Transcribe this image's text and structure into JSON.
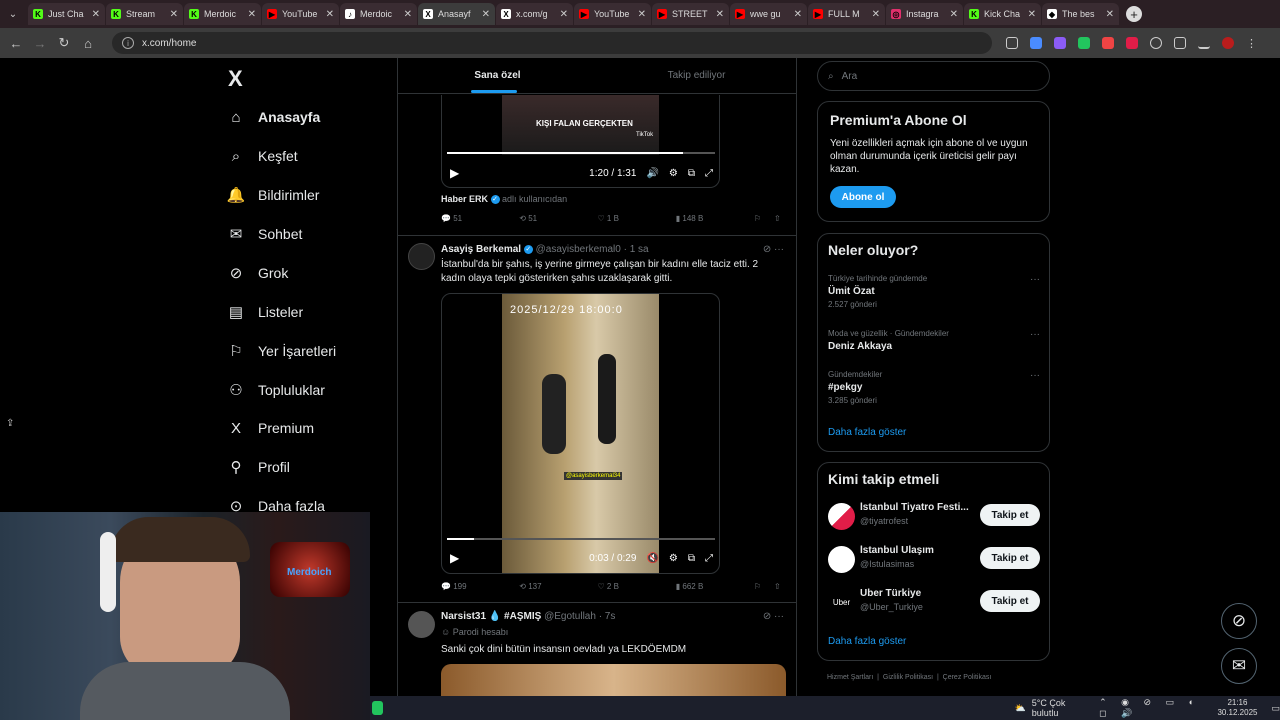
{
  "tabs": [
    {
      "title": "Just Cha",
      "color": "#53fc18",
      "glyph": "K"
    },
    {
      "title": "Stream",
      "color": "#53fc18",
      "glyph": "K"
    },
    {
      "title": "Merdoic",
      "color": "#53fc18",
      "glyph": "K"
    },
    {
      "title": "YouTube",
      "color": "#ff0000",
      "glyph": "▶"
    },
    {
      "title": "Merdoic",
      "color": "#ffffff",
      "glyph": "♪"
    },
    {
      "title": "Anasayf",
      "color": "#ffffff",
      "glyph": "X"
    },
    {
      "title": "x.com/g",
      "color": "#ffffff",
      "glyph": "X"
    },
    {
      "title": "YouTube",
      "color": "#ff0000",
      "glyph": "▶"
    },
    {
      "title": "STREET",
      "color": "#ff0000",
      "glyph": "▶"
    },
    {
      "title": "wwe gu",
      "color": "#ff0000",
      "glyph": "▶"
    },
    {
      "title": "FULL M",
      "color": "#ff0000",
      "glyph": "▶"
    },
    {
      "title": "Instagra",
      "color": "#e1306c",
      "glyph": "◎"
    },
    {
      "title": "Kick Cha",
      "color": "#53fc18",
      "glyph": "K"
    },
    {
      "title": "The bes",
      "color": "#ffffff",
      "glyph": "◆"
    }
  ],
  "browser": {
    "url": "x.com/home"
  },
  "sidebar": {
    "logo": "X",
    "items": [
      {
        "label": "Anasayfa",
        "icon": "⌂",
        "bold": true
      },
      {
        "label": "Keşfet",
        "icon": "⌕"
      },
      {
        "label": "Bildirimler",
        "icon": "🔔"
      },
      {
        "label": "Sohbet",
        "icon": "✉"
      },
      {
        "label": "Grok",
        "icon": "⊘"
      },
      {
        "label": "Listeler",
        "icon": "▤"
      },
      {
        "label": "Yer İşaretleri",
        "icon": "⚐"
      },
      {
        "label": "Topluluklar",
        "icon": "⚇"
      },
      {
        "label": "Premium",
        "icon": "X"
      },
      {
        "label": "Profil",
        "icon": "⚲"
      },
      {
        "label": "Daha fazla",
        "icon": "⊙"
      }
    ]
  },
  "feed": {
    "tabs": [
      "Sana özel",
      "Takip ediliyor"
    ],
    "tweet1": {
      "overlay_text": "KIŞI FALAN GERÇEKTEN",
      "brand": "TikTok",
      "time": "1:20 / 1:31",
      "progress": 0.88,
      "source_name": "Haber ERK",
      "source_note": "adlı kullanıcıdan",
      "replies": "51",
      "reposts": "51",
      "likes": "1 B",
      "views": "148 B"
    },
    "tweet2": {
      "name": "Asayiş Berkemal",
      "handle": "@asayisberkemal0 · 1 sa",
      "text": "İstanbul'da bir şahıs, iş yerine girmeye çalışan bir kadını elle taciz etti. 2 kadın olaya tepki gösterirken şahıs uzaklaşarak gitti.",
      "timestamp_overlay": "2025/12/29 18:00:0",
      "watermark": "@asayisberkemal34",
      "time": "0:03 / 0:29",
      "progress": 0.1,
      "replies": "199",
      "reposts": "137",
      "likes": "2 B",
      "views": "662 B"
    },
    "tweet3": {
      "name": "Narsist31",
      "name_suffix": "#AŞMIŞ",
      "handle": "@Egotullah · 7s",
      "parody": "Parodi hesabı",
      "text": "Sanki çok dini bütün insansın oevladı ya LEKDÖEMDM"
    }
  },
  "right": {
    "search_placeholder": "Ara",
    "premium": {
      "title": "Premium'a Abone Ol",
      "body": "Yeni özellikleri açmak için abone ol ve uygun olman durumunda içerik üreticisi gelir payı kazan.",
      "button": "Abone ol"
    },
    "trends": {
      "title": "Neler oluyor?",
      "items": [
        {
          "context": "Türkiye tarihinde gündemde",
          "topic": "Ümit Özat",
          "count": "2.527 gönderi"
        },
        {
          "context": "Moda ve güzellik · Gündemdekiler",
          "topic": "Deniz Akkaya",
          "count": ""
        },
        {
          "context": "Gündemdekiler",
          "topic": "#pekgy",
          "count": "3.285 gönderi"
        }
      ],
      "more": "Daha fazla göster"
    },
    "who_to_follow": {
      "title": "Kimi takip etmeli",
      "items": [
        {
          "name": "İstanbul Tiyatro Festi...",
          "handle": "@tiyatrofest",
          "button": "Takip et"
        },
        {
          "name": "İstanbul Ulaşım",
          "handle": "@Istulasimas",
          "button": "Takip et"
        },
        {
          "name": "Uber Türkiye",
          "handle": "@Uber_Turkiye",
          "button": "Takip et",
          "logo": "Uber"
        }
      ],
      "more": "Daha fazla göster"
    },
    "footer": "Hizmet Şartları  |  Gizlilik Politikası  |  Çerez Politikası"
  },
  "webcam": {
    "sign": "Merdoich"
  },
  "taskbar": {
    "weather": "5°C  Çok bulutlu",
    "time": "21:16",
    "date": "30.12.2025"
  }
}
